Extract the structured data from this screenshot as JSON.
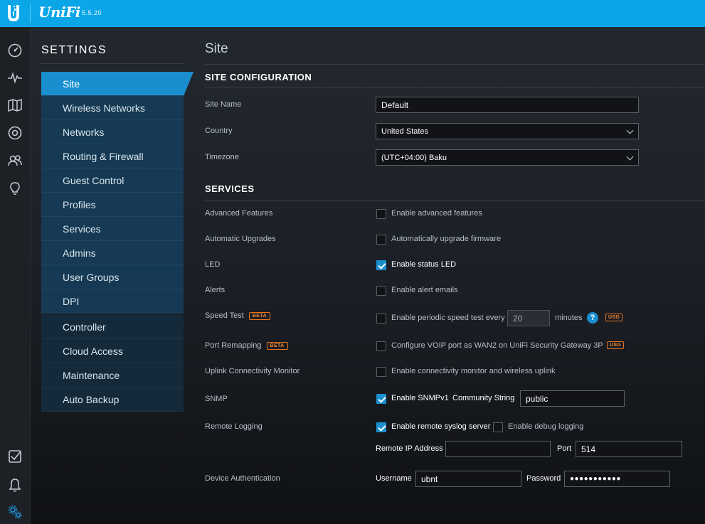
{
  "app": {
    "brand": "UniFi",
    "version": "5.5.20"
  },
  "rail": {
    "icons": [
      "dashboard-icon",
      "statistics-icon",
      "map-icon",
      "devices-icon",
      "clients-icon",
      "insights-icon",
      "events-icon",
      "alerts-icon",
      "settings-icon"
    ]
  },
  "settings": {
    "title": "SETTINGS",
    "nav_primary": [
      "Site",
      "Wireless Networks",
      "Networks",
      "Routing & Firewall",
      "Guest Control",
      "Profiles",
      "Services",
      "Admins",
      "User Groups",
      "DPI"
    ],
    "nav_secondary": [
      "Controller",
      "Cloud Access",
      "Maintenance",
      "Auto Backup"
    ],
    "active": "Site"
  },
  "page": {
    "title": "Site"
  },
  "site_config": {
    "heading": "SITE CONFIGURATION",
    "site_name_label": "Site Name",
    "site_name_value": "Default",
    "country_label": "Country",
    "country_value": "United States",
    "timezone_label": "Timezone",
    "timezone_value": "(UTC+04:00) Baku"
  },
  "services": {
    "heading": "SERVICES",
    "advanced_label": "Advanced Features",
    "advanced_text": "Enable advanced features",
    "upgrades_label": "Automatic Upgrades",
    "upgrades_text": "Automatically upgrade firmware",
    "led_label": "LED",
    "led_text": "Enable status LED",
    "alerts_label": "Alerts",
    "alerts_text": "Enable alert emails",
    "speed_label": "Speed Test",
    "beta": "BETA",
    "speed_text": "Enable periodic speed test every",
    "speed_value": "20",
    "speed_unit": "minutes",
    "help": "?",
    "usg": "USG",
    "remap_label": "Port Remapping",
    "remap_text": "Configure VOIP port as WAN2 on UniFi Security Gateway 3P",
    "uplink_label": "Uplink Connectivity Monitor",
    "uplink_text": "Enable connectivity monitor and wireless uplink",
    "snmp_label": "SNMP",
    "snmp_text": "Enable SNMPv1",
    "community_label": "Community String",
    "community_value": "public",
    "logging_label": "Remote Logging",
    "syslog_text": "Enable remote syslog server",
    "debug_text": "Enable debug logging",
    "remote_ip_label": "Remote IP Address",
    "remote_ip_value": "",
    "port_label": "Port",
    "port_value": "514",
    "auth_label": "Device Authentication",
    "username_label": "Username",
    "username_value": "ubnt",
    "password_label": "Password",
    "password_value": "●●●●●●●●●●●"
  },
  "checks": {
    "advanced": false,
    "upgrades": false,
    "led": true,
    "alerts": false,
    "speed": false,
    "remap": false,
    "uplink": false,
    "snmp": true,
    "syslog": true,
    "debug": false
  },
  "colors": {
    "topbar": "#0aa6e8",
    "accent": "#1a8fd0",
    "beta": "#e8711a"
  }
}
